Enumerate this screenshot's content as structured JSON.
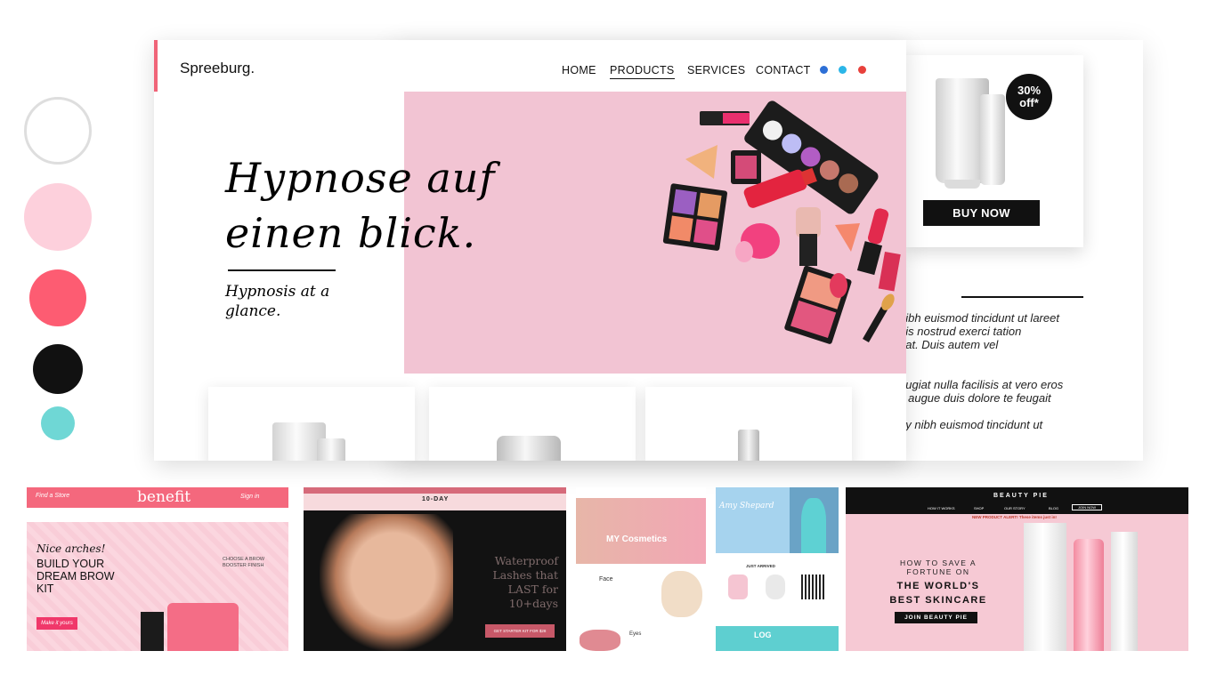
{
  "swatches": {
    "colors": [
      "#ffffff",
      "#fdd0dc",
      "#fd5c72",
      "#111111",
      "#6fd7d5"
    ]
  },
  "header": {
    "logo": "Spreeburg.",
    "nav": [
      {
        "label": "HOME"
      },
      {
        "label": "PRODUCTS",
        "active": true
      },
      {
        "label": "SERVICES"
      },
      {
        "label": "CONTACT"
      }
    ],
    "social_icons": [
      "circle-blue-icon",
      "circle-cyan-icon",
      "circle-red-icon"
    ]
  },
  "hero": {
    "headline": "Hypnose auf einen blick.",
    "subheadline": "Hypnosis at a glance."
  },
  "promo": {
    "badge": "30% off*",
    "button": "BUY NOW"
  },
  "side_text": {
    "paragraph1": "nibh euismod tincidunt ut lareet\nuis nostrud exerci tation\nuat. Duis autem vel",
    "paragraph2": "eugiat nulla facilisis at vero eros\nit augue duis dolore te feugait",
    "paragraph3": "ny nibh euismod tincidunt ut"
  },
  "thumbnails": {
    "benefit": {
      "brand": "benefit",
      "nav": "Find a Store",
      "nav_right": "Sign in",
      "headline_script": "Nice arches!",
      "headline": "BUILD YOUR DREAM BROW KIT",
      "note": "CHOOSE A BROW BOOSTER FINISH",
      "button": "Make it yours"
    },
    "lashes": {
      "brand": "10-DAY",
      "headline": "Waterproof Lashes that LAST for 10+days",
      "button": "GET STARTER KIT FOR $28"
    },
    "my_cosmetics": {
      "brand": "MY Cosmetics",
      "section1": "Face",
      "section2": "Eyes"
    },
    "amy": {
      "brand": "Amy Shepard",
      "section": "JUST ARRIVED",
      "footer": "LOG"
    },
    "beauty_pie": {
      "brand": "BEAUTY PIE",
      "nav": [
        "HOW IT WORKS",
        "SHOP",
        "OUR STORY",
        "BLOG",
        "JOIN NOW"
      ],
      "alert": "NEW PRODUCT ALERT! These items just in!",
      "headline1": "HOW TO SAVE A FORTUNE ON",
      "headline2": "THE WORLD'S BEST SKINCARE",
      "button": "JOIN BEAUTY PIE"
    }
  }
}
